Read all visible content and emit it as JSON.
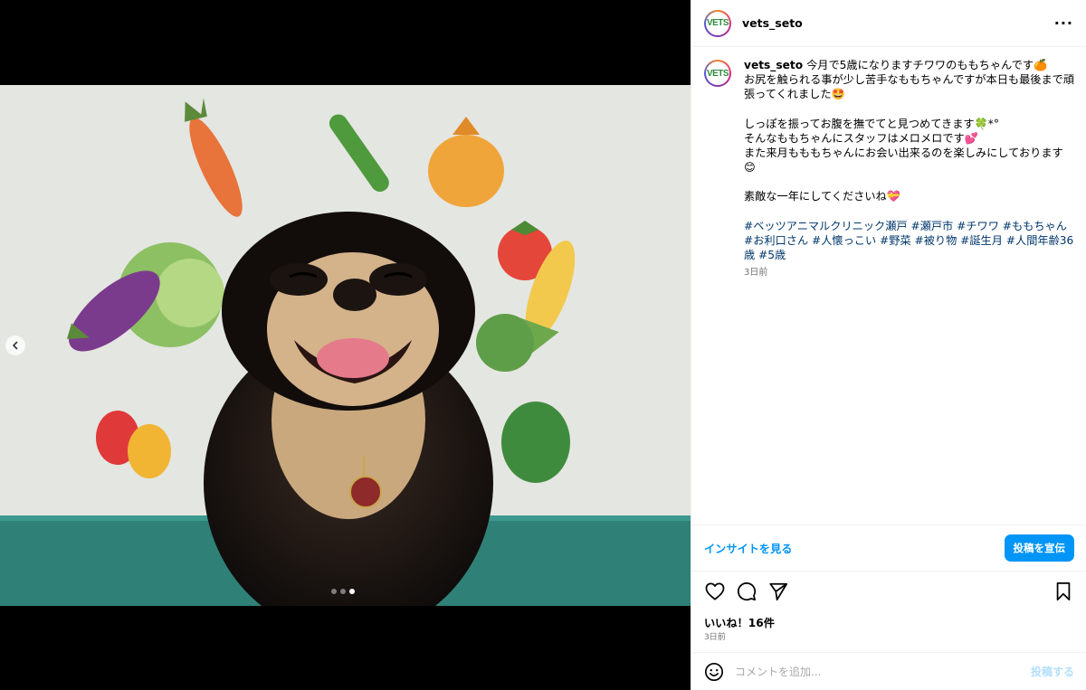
{
  "post": {
    "username": "vets_seto",
    "more_icon": "more-horizontal-icon",
    "avatar_logo": "VETS",
    "caption": {
      "lines": [
        "今月で5歳になりますチワワのももちゃんです🍊",
        "お尻を触られる事が少し苦手なももちゃんですが本日も最後まで頑張ってくれました🤩",
        "",
        "しっぽを振ってお腹を撫でてと見つめてきます🍀*°",
        "そんなももちゃんにスタッフはメロメロです💕",
        "また来月もももちゃんにお会い出来るのを楽しみにしております😊",
        "",
        "素敵な一年にしてくださいね💝",
        ""
      ],
      "hashtags": "#ベッツアニマルクリニック瀬戸 #瀬戸市 #チワワ #ももちゃん #お利口さん #人懐っこい #野菜 #被り物 #誕生月 #人間年齢36歳 #5歳",
      "time_ago": "3日前"
    },
    "insights_link": "インサイトを見る",
    "promote_button": "投稿を宣伝",
    "likes_text": "いいね！16件",
    "posted_ago": "3日前",
    "comment": {
      "placeholder": "コメントを追加...",
      "post_button": "投稿する"
    },
    "carousel": {
      "slide_count": 3,
      "active_index": 2
    },
    "colors": {
      "accent": "#0095f6",
      "hashtag": "#00376b",
      "muted": "#737373"
    }
  }
}
